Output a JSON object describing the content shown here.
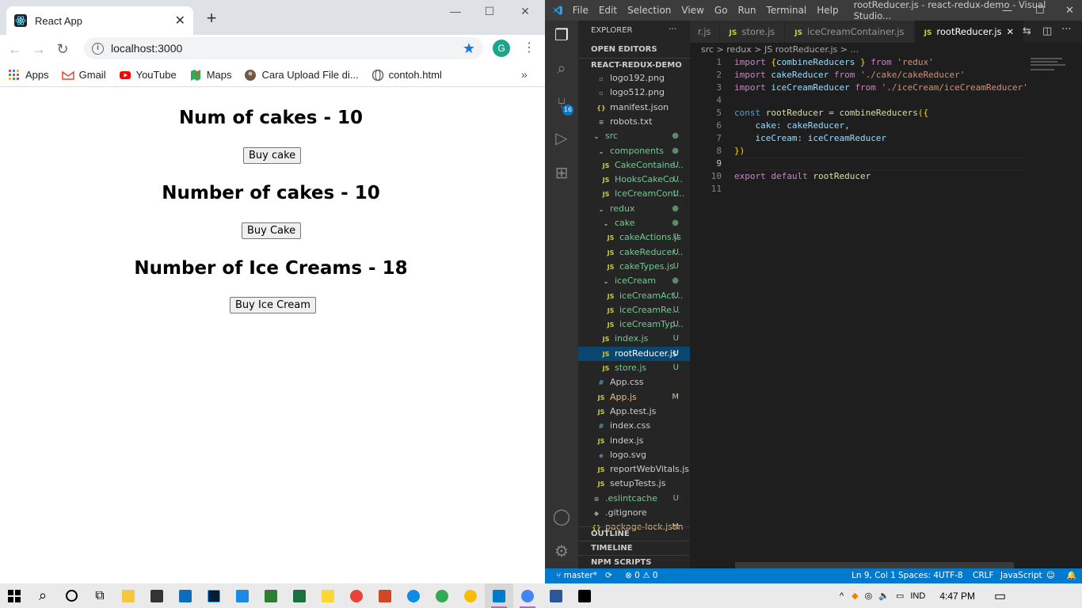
{
  "chrome": {
    "tab_title": "React App",
    "url": "localhost:3000",
    "profile_initial": "G",
    "bookmarks": [
      {
        "label": "Apps",
        "icon": "apps-grid-icon"
      },
      {
        "label": "Gmail",
        "icon": "gmail-icon"
      },
      {
        "label": "YouTube",
        "icon": "youtube-icon"
      },
      {
        "label": "Maps",
        "icon": "maps-icon"
      },
      {
        "label": "Cara Upload File di...",
        "icon": "avatar-icon"
      },
      {
        "label": "contoh.html",
        "icon": "globe-icon"
      }
    ]
  },
  "page": {
    "h1": "Num of cakes - 10",
    "btn1": "Buy cake",
    "h2": "Number of cakes - 10",
    "btn2": "Buy Cake",
    "h3": "Number of Ice Creams - 18",
    "btn3": "Buy Ice Cream"
  },
  "vscode": {
    "menu": [
      "File",
      "Edit",
      "Selection",
      "View",
      "Go",
      "Run",
      "Terminal",
      "Help"
    ],
    "title": "rootReducer.js - react-redux-demo - Visual Studio...",
    "explorer_title": "EXPLORER",
    "explorer_more": "···",
    "open_editors": "OPEN EDITORS",
    "project": "REACT-REDUX-DEMO",
    "scm_badge": "16",
    "tabs": [
      {
        "label": "r.js"
      },
      {
        "label": "store.js"
      },
      {
        "label": "iceCreamContainer.js"
      },
      {
        "label": "rootReducer.js"
      }
    ],
    "breadcrumb": "src > redux > JS rootReducer.js > ...",
    "files": [
      {
        "label": "logo192.png",
        "ico": "▫",
        "badge": ""
      },
      {
        "label": "logo512.png",
        "ico": "▫",
        "badge": ""
      },
      {
        "label": "manifest.json",
        "ico": "{}",
        "badge": ""
      },
      {
        "label": "robots.txt",
        "ico": "≡",
        "badge": ""
      },
      {
        "label": "src",
        "ico": "⌄",
        "badge": "●"
      },
      {
        "label": "components",
        "ico": "⌄",
        "badge": "●"
      },
      {
        "label": "CakeContaine...",
        "ico": "JS",
        "badge": "U"
      },
      {
        "label": "HooksCakeCo...",
        "ico": "JS",
        "badge": "U"
      },
      {
        "label": "IceCreamCont...",
        "ico": "JS",
        "badge": "U"
      },
      {
        "label": "redux",
        "ico": "⌄",
        "badge": "●"
      },
      {
        "label": "cake",
        "ico": "⌄",
        "badge": "●"
      },
      {
        "label": "cakeActions.js",
        "ico": "JS",
        "badge": "U"
      },
      {
        "label": "cakeReducer...",
        "ico": "JS",
        "badge": "U"
      },
      {
        "label": "cakeTypes.js",
        "ico": "JS",
        "badge": "U"
      },
      {
        "label": "iceCream",
        "ico": "⌄",
        "badge": "●"
      },
      {
        "label": "iceCreamAct...",
        "ico": "JS",
        "badge": "U"
      },
      {
        "label": "iceCreamRe...",
        "ico": "JS",
        "badge": "U"
      },
      {
        "label": "iceCreamTyp...",
        "ico": "JS",
        "badge": "U"
      },
      {
        "label": "index.js",
        "ico": "JS",
        "badge": "U"
      },
      {
        "label": "rootReducer.js",
        "ico": "JS",
        "badge": "U"
      },
      {
        "label": "store.js",
        "ico": "JS",
        "badge": "U"
      },
      {
        "label": "App.css",
        "ico": "#",
        "badge": ""
      },
      {
        "label": "App.js",
        "ico": "JS",
        "badge": "M"
      },
      {
        "label": "App.test.js",
        "ico": "JS",
        "badge": ""
      },
      {
        "label": "index.css",
        "ico": "#",
        "badge": ""
      },
      {
        "label": "index.js",
        "ico": "JS",
        "badge": ""
      },
      {
        "label": "logo.svg",
        "ico": "◈",
        "badge": ""
      },
      {
        "label": "reportWebVitals.js",
        "ico": "JS",
        "badge": ""
      },
      {
        "label": "setupTests.js",
        "ico": "JS",
        "badge": ""
      },
      {
        "label": ".eslintcache",
        "ico": "≡",
        "badge": "U"
      },
      {
        "label": ".gitignore",
        "ico": "◆",
        "badge": ""
      },
      {
        "label": "package-lock.json",
        "ico": "{}",
        "badge": "M"
      }
    ],
    "outline": "OUTLINE",
    "timeline": "TIMELINE",
    "npm": "NPM SCRIPTS",
    "line_numbers": [
      "1",
      "2",
      "3",
      "4",
      "5",
      "6",
      "7",
      "8",
      "9",
      "10",
      "11"
    ],
    "status": {
      "branch": "master*",
      "errors": "⊗ 0 ⚠ 0",
      "position": "Ln 9, Col 1",
      "spaces": "Spaces: 4",
      "encoding": "UTF-8",
      "eol": "CRLF",
      "language": "JavaScript"
    }
  },
  "code": {
    "l1": {
      "a": "import ",
      "b": "{",
      "c": "combineReducers",
      "d": " } ",
      "e": "from ",
      "f": "'redux'"
    },
    "l2": {
      "a": "import ",
      "b": "cakeReducer ",
      "c": "from ",
      "d": "'./cake/cakeReducer'"
    },
    "l3": {
      "a": "import ",
      "b": "iceCreamReducer ",
      "c": "from ",
      "d": "'./iceCream/iceCreamReducer'"
    },
    "l5": {
      "a": "const ",
      "b": "rootReducer ",
      "c": "= ",
      "d": "combineReducers",
      "e": "({"
    },
    "l6": {
      "a": "    cake: ",
      "b": "cakeReducer,"
    },
    "l7": {
      "a": "    iceCream: ",
      "b": "iceCreamReducer"
    },
    "l8": {
      "a": "})"
    },
    "l10": {
      "a": "export ",
      "b": "default ",
      "c": "rootReducer"
    }
  },
  "taskbar": {
    "lang": "IND",
    "time": "4:47 PM"
  }
}
